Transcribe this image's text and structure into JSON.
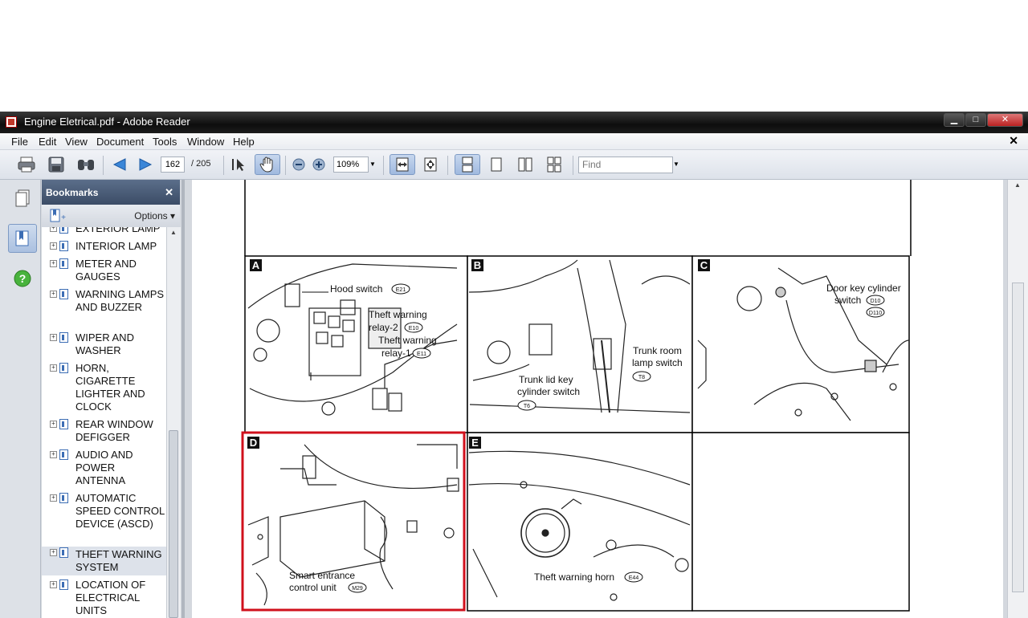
{
  "window": {
    "title": "Engine Eletrical.pdf - Adobe Reader"
  },
  "menubar": {
    "items": [
      "File",
      "Edit",
      "View",
      "Document",
      "Tools",
      "Window",
      "Help"
    ],
    "close": "✕"
  },
  "toolbar": {
    "page_current": "162",
    "page_total": "/ 205",
    "zoom": "109%",
    "find_placeholder": "Find"
  },
  "bookmarks": {
    "title": "Bookmarks",
    "options": "Options",
    "items": [
      {
        "label": "EXTERIOR LAMP"
      },
      {
        "label": "INTERIOR LAMP"
      },
      {
        "label": "METER AND GAUGES"
      },
      {
        "label": "WARNING LAMPS AND BUZZER"
      },
      {
        "label": "WIPER AND WASHER"
      },
      {
        "label": "HORN, CIGARETTE LIGHTER AND CLOCK"
      },
      {
        "label": "REAR WINDOW DEFIGGER"
      },
      {
        "label": "AUDIO AND POWER ANTENNA"
      },
      {
        "label": "AUTOMATIC SPEED CONTROL DEVICE (ASCD)"
      },
      {
        "label": "THEFT WARNING SYSTEM",
        "selected": true
      },
      {
        "label": "LOCATION OF ELECTRICAL UNITS"
      }
    ]
  },
  "document": {
    "panels": {
      "a": {
        "letter": "A",
        "labels": [
          "Hood switch",
          "Theft warning",
          "relay-2",
          "Theft warning",
          "relay-1"
        ],
        "codes": [
          "E21",
          "E10",
          "E11"
        ]
      },
      "b": {
        "letter": "B",
        "labels": [
          "Trunk room",
          "lamp switch",
          "Trunk lid key",
          "cylinder switch"
        ],
        "codes": [
          "T8",
          "T6"
        ]
      },
      "c": {
        "letter": "C",
        "labels": [
          "Door key cylinder",
          "switch"
        ],
        "codes": [
          "D10",
          "D110"
        ]
      },
      "d": {
        "letter": "D",
        "labels": [
          "Smart entrance",
          "control unit"
        ],
        "codes": [
          "M29"
        ]
      },
      "e": {
        "letter": "E",
        "labels": [
          "Theft warning horn"
        ],
        "codes": [
          "E44"
        ]
      }
    },
    "highlight_color": "#d0101c"
  }
}
